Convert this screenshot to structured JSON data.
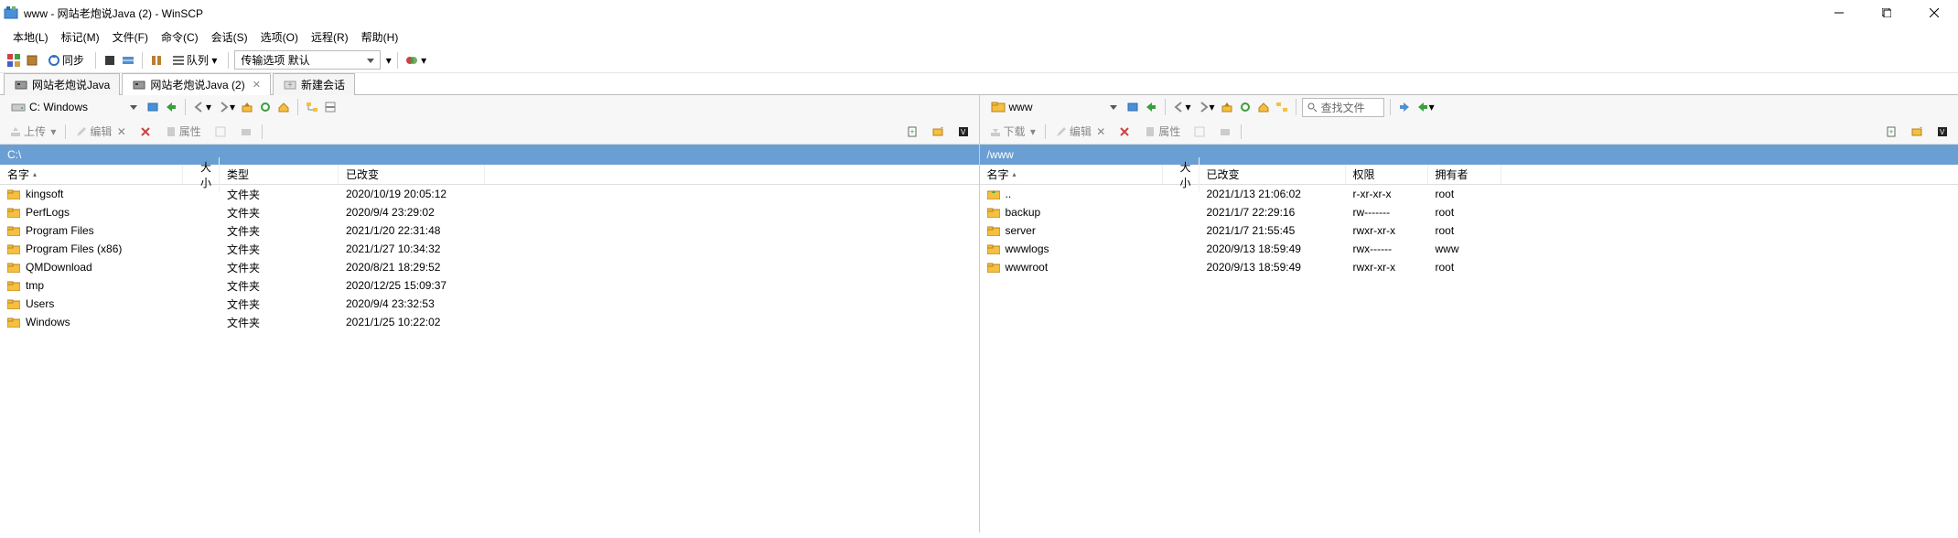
{
  "window": {
    "title": "www - 网站老炮说Java (2) - WinSCP"
  },
  "menu": {
    "items": [
      "本地(L)",
      "标记(M)",
      "文件(F)",
      "命令(C)",
      "会话(S)",
      "选项(O)",
      "远程(R)",
      "帮助(H)"
    ]
  },
  "toolbar1": {
    "sync": "同步",
    "queue": "队列",
    "transfer": "传输选项 默认"
  },
  "tabs": {
    "t1": "网站老炮说Java",
    "t2": "网站老炮说Java (2)",
    "t3": "新建会话"
  },
  "left": {
    "drive": "C: Windows",
    "search_placeholder": "",
    "action_upload": "上传",
    "action_edit": "编辑",
    "action_props": "属性",
    "path": "C:\\",
    "cols": {
      "name": "名字",
      "size": "大小",
      "type": "类型",
      "changed": "已改变"
    },
    "rows": [
      {
        "name": "kingsoft",
        "type": "文件夹",
        "changed": "2020/10/19  20:05:12"
      },
      {
        "name": "PerfLogs",
        "type": "文件夹",
        "changed": "2020/9/4  23:29:02"
      },
      {
        "name": "Program Files",
        "type": "文件夹",
        "changed": "2021/1/20  22:31:48"
      },
      {
        "name": "Program Files (x86)",
        "type": "文件夹",
        "changed": "2021/1/27  10:34:32"
      },
      {
        "name": "QMDownload",
        "type": "文件夹",
        "changed": "2020/8/21  18:29:52"
      },
      {
        "name": "tmp",
        "type": "文件夹",
        "changed": "2020/12/25  15:09:37"
      },
      {
        "name": "Users",
        "type": "文件夹",
        "changed": "2020/9/4  23:32:53"
      },
      {
        "name": "Windows",
        "type": "文件夹",
        "changed": "2021/1/25  10:22:02"
      }
    ]
  },
  "right": {
    "drive": "www",
    "search_label": "查找文件",
    "action_download": "下载",
    "action_edit": "编辑",
    "action_props": "属性",
    "path": "/www",
    "cols": {
      "name": "名字",
      "size": "大小",
      "changed": "已改变",
      "perm": "权限",
      "owner": "拥有者"
    },
    "rows": [
      {
        "name": "..",
        "changed": "2021/1/13 21:06:02",
        "perm": "r-xr-xr-x",
        "owner": "root",
        "parent": true
      },
      {
        "name": "backup",
        "changed": "2021/1/7 22:29:16",
        "perm": "rw-------",
        "owner": "root"
      },
      {
        "name": "server",
        "changed": "2021/1/7 21:55:45",
        "perm": "rwxr-xr-x",
        "owner": "root"
      },
      {
        "name": "wwwlogs",
        "changed": "2020/9/13 18:59:49",
        "perm": "rwx------",
        "owner": "www"
      },
      {
        "name": "wwwroot",
        "changed": "2020/9/13 18:59:49",
        "perm": "rwxr-xr-x",
        "owner": "root"
      }
    ]
  }
}
